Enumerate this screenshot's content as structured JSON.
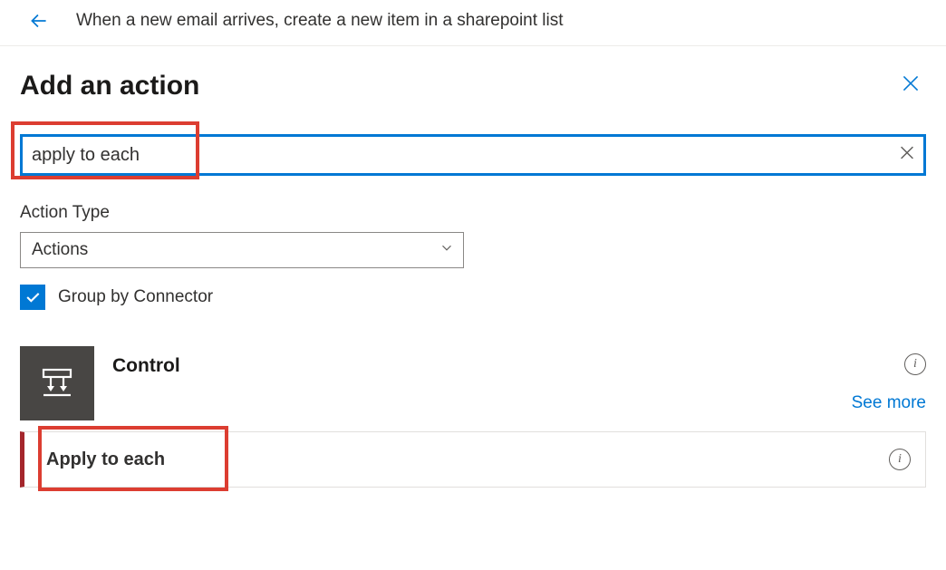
{
  "topbar": {
    "title": "When a new email arrives, create a new item in a sharepoint list"
  },
  "panel": {
    "title": "Add an action"
  },
  "search": {
    "value": "apply to each"
  },
  "action_type": {
    "label": "Action Type",
    "selected": "Actions"
  },
  "group_checkbox": {
    "label": "Group by Connector",
    "checked": true
  },
  "connector": {
    "name": "Control",
    "see_more": "See more"
  },
  "action_item": {
    "label": "Apply to each"
  }
}
